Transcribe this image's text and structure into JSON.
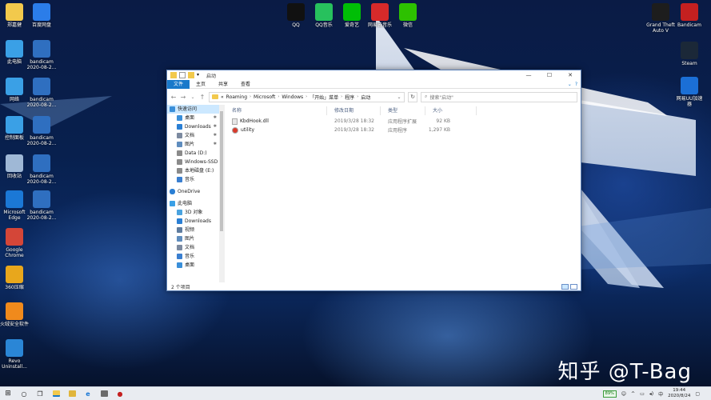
{
  "desktop": {
    "left_icons": [
      {
        "label": "郑嘉健",
        "color": "#f2c94c",
        "glyph": "user-folder-icon"
      },
      {
        "label": "百度网盘",
        "color": "#2b7de9",
        "glyph": "baidu-netdisk-icon"
      },
      {
        "label": "此电脑",
        "color": "#3aa0e6",
        "glyph": "this-pc-icon"
      },
      {
        "label": "bandicam\n2020-08-2...",
        "color": "#2f6fc0",
        "glyph": "video-file-icon"
      },
      {
        "label": "网络",
        "color": "#3aa0e6",
        "glyph": "network-icon"
      },
      {
        "label": "bandicam\n2020-08-2...",
        "color": "#2f6fc0",
        "glyph": "video-file-icon"
      },
      {
        "label": "控制面板",
        "color": "#3aa0e6",
        "glyph": "control-panel-icon"
      },
      {
        "label": "bandicam\n2020-08-2...",
        "color": "#2f6fc0",
        "glyph": "video-file-icon"
      },
      {
        "label": "回收站",
        "color": "#9fb8d6",
        "glyph": "recycle-bin-icon"
      },
      {
        "label": "bandicam\n2020-08-2...",
        "color": "#2f6fc0",
        "glyph": "video-file-icon"
      },
      {
        "label": "Microsoft\nEdge",
        "color": "#1b78d6",
        "glyph": "edge-icon"
      },
      {
        "label": "bandicam\n2020-08-2...",
        "color": "#2f6fc0",
        "glyph": "video-file-icon"
      },
      {
        "label": "Google\nChrome",
        "color": "#d44638",
        "glyph": "chrome-icon"
      },
      {
        "label": "360压缩",
        "color": "#e8a71c",
        "glyph": "archive-icon"
      },
      {
        "label": "火绒安全软件",
        "color": "#f08a1c",
        "glyph": "huorong-icon"
      },
      {
        "label": "Revo\nUninstall...",
        "color": "#2a86d6",
        "glyph": "revo-icon"
      }
    ],
    "top_icons": [
      {
        "label": "QQ",
        "color": "#111111",
        "glyph": "qq-icon"
      },
      {
        "label": "QQ音乐",
        "color": "#27c15d",
        "glyph": "qq-music-icon"
      },
      {
        "label": "爱奇艺",
        "color": "#00be06",
        "glyph": "iqiyi-icon"
      },
      {
        "label": "网易云音乐",
        "color": "#d62a2a",
        "glyph": "netease-music-icon"
      },
      {
        "label": "微信",
        "color": "#2dc100",
        "glyph": "wechat-icon"
      }
    ],
    "right_icons": [
      {
        "label": "Grand Theft\nAuto V",
        "color": "#1d1d1d",
        "glyph": "gta-icon"
      },
      {
        "label": "Bandicam",
        "color": "#c42020",
        "glyph": "bandicam-icon"
      },
      {
        "label": "Steam",
        "color": "#1b2838",
        "glyph": "steam-icon"
      },
      {
        "label": "网易UU加速\n器",
        "color": "#1b6fd6",
        "glyph": "uu-accelerator-icon"
      }
    ],
    "watermark": "知乎 @T-Bag"
  },
  "explorer": {
    "title": "启动",
    "ribbon_tabs": [
      "文件",
      "主页",
      "共享",
      "查看"
    ],
    "address": {
      "prefix": "«",
      "crumbs": [
        "Roaming",
        "Microsoft",
        "Windows",
        "「开始」菜单",
        "程序",
        "启动"
      ]
    },
    "search_placeholder": "搜索\"启动\"",
    "sidebar": {
      "quick_access": "快速访问",
      "quick_items": [
        {
          "label": "桌面",
          "icon": "desktop-icon",
          "color": "#3a8fd9",
          "pinned": true
        },
        {
          "label": "Downloads",
          "icon": "download-icon",
          "color": "#2a7fd4",
          "pinned": true
        },
        {
          "label": "文档",
          "icon": "documents-icon",
          "color": "#7c8aa0",
          "pinned": true
        },
        {
          "label": "图片",
          "icon": "pictures-icon",
          "color": "#5f8dbe",
          "pinned": true
        },
        {
          "label": "Data (D:)",
          "icon": "drive-icon",
          "color": "#8a8a8a",
          "pinned": false
        },
        {
          "label": "Windows-SSD",
          "icon": "drive-icon",
          "color": "#8a8a8a",
          "pinned": false
        },
        {
          "label": "本地磁盘 (E:)",
          "icon": "drive-icon",
          "color": "#8a8a8a",
          "pinned": false
        },
        {
          "label": "音乐",
          "icon": "music-icon",
          "color": "#3a7fd0",
          "pinned": false
        }
      ],
      "onedrive": "OneDrive",
      "this_pc": "此电脑",
      "pc_items": [
        {
          "label": "3D 对象",
          "icon": "3d-objects-icon",
          "color": "#4aa3df"
        },
        {
          "label": "Downloads",
          "icon": "download-icon",
          "color": "#2a7fd4"
        },
        {
          "label": "视频",
          "icon": "videos-icon",
          "color": "#5f7c9e"
        },
        {
          "label": "图片",
          "icon": "pictures-icon",
          "color": "#5f8dbe"
        },
        {
          "label": "文档",
          "icon": "documents-icon",
          "color": "#7c8aa0"
        },
        {
          "label": "音乐",
          "icon": "music-icon",
          "color": "#3a7fd0"
        },
        {
          "label": "桌面",
          "icon": "desktop-icon",
          "color": "#3a8fd9"
        }
      ]
    },
    "columns": [
      "名称",
      "修改日期",
      "类型",
      "大小"
    ],
    "files": [
      {
        "name": "KbdHook.dll",
        "date": "2019/3/28 18:32",
        "type": "应用程序扩展",
        "size": "92 KB",
        "icon": "dll-file-icon"
      },
      {
        "name": "utility",
        "date": "2019/3/28 18:32",
        "type": "应用程序",
        "size": "1,297 KB",
        "icon": "app-file-icon"
      }
    ],
    "status": "2 个项目"
  },
  "taskbar": {
    "battery": "89%",
    "time": "19:44",
    "date": "2020/8/24",
    "language": "中"
  }
}
